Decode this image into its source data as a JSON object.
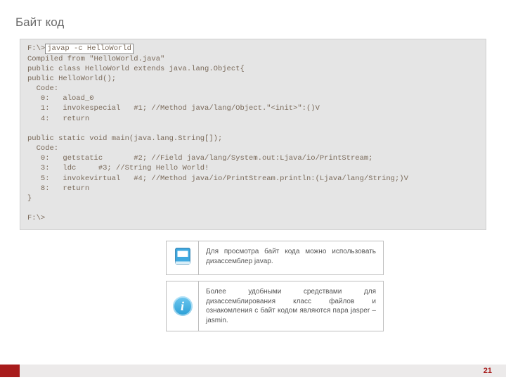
{
  "slide": {
    "title": "Байт код",
    "pageNumber": "21"
  },
  "code": {
    "prompt1": "F:\\>",
    "command": "javap -c HelloWorld",
    "body": "Compiled from \"HelloWorld.java\"\npublic class HelloWorld extends java.lang.Object{\npublic HelloWorld();\n  Code:\n   0:   aload_0\n   1:   invokespecial   #1; //Method java/lang/Object.\"<init>\":()V\n   4:   return\n\npublic static void main(java.lang.String[]);\n  Code:\n   0:   getstatic       #2; //Field java/lang/System.out:Ljava/io/PrintStream;\n   3:   ldc     #3; //String Hello World!\n   5:   invokevirtual   #4; //Method java/io/PrintStream.println:(Ljava/lang/String;)V\n   8:   return\n}\n\nF:\\>"
  },
  "notes": {
    "box1": "Для просмотра байт кода можно использовать дизассемблер javap.",
    "box2": "Более удобными средствами для дизассемблирования класс файлов и ознакомления с байт кодом являются пара jasper – jasmin."
  }
}
